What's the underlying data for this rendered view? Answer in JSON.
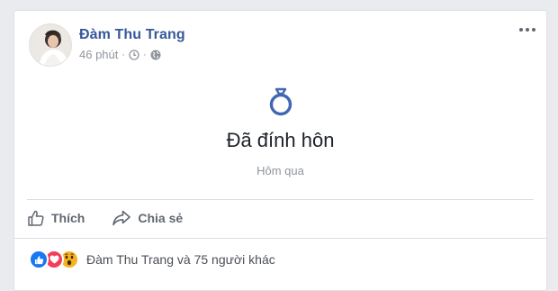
{
  "post": {
    "author": "Đàm Thu Trang",
    "time": "46 phút",
    "life_event": {
      "title": "Đã đính hôn",
      "date": "Hôm qua",
      "icon": "ring-icon"
    },
    "actions": {
      "like_label": "Thích",
      "share_label": "Chia sẻ"
    },
    "reactions": {
      "types": [
        "like",
        "love",
        "wow"
      ],
      "text": "Đàm Thu Trang và 75 người khác"
    }
  },
  "colors": {
    "author": "#365899",
    "like": "#1877f2",
    "love": "#f33e58",
    "wow": "#f7b125",
    "muted": "#90949c"
  }
}
